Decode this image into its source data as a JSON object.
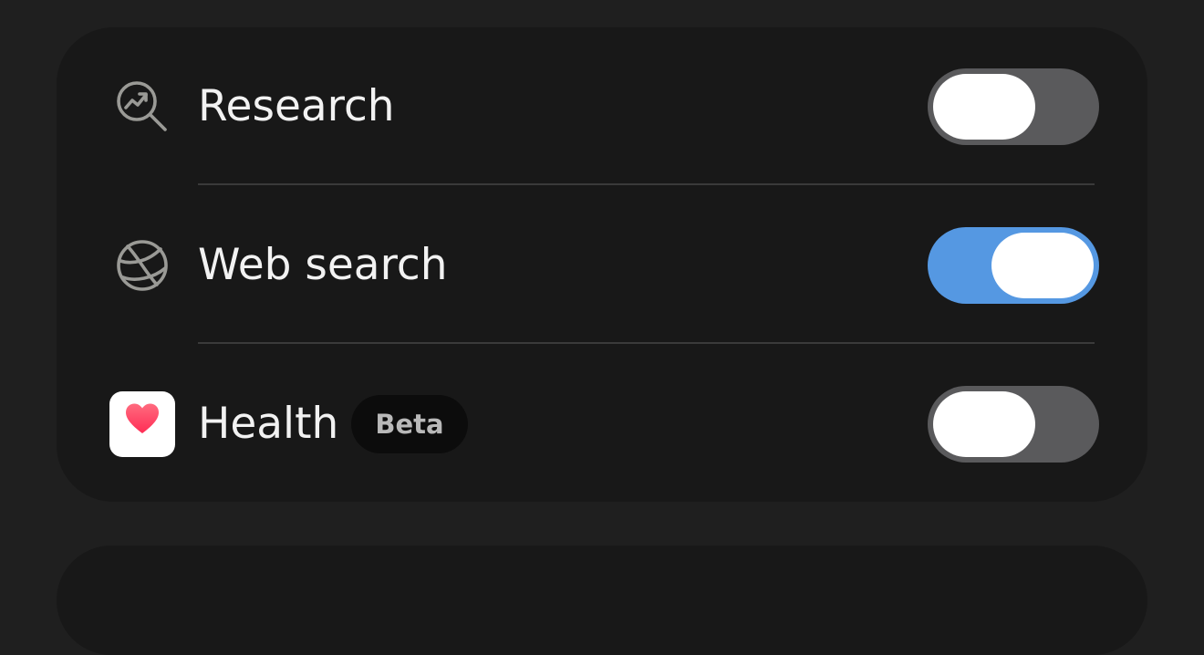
{
  "settings": {
    "items": [
      {
        "label": "Research",
        "icon": "chart-magnifier-icon",
        "enabled": false
      },
      {
        "label": "Web search",
        "icon": "globe-icon",
        "enabled": true
      },
      {
        "label": "Health",
        "icon": "health-app-icon",
        "badge": "Beta",
        "enabled": false
      }
    ]
  },
  "colors": {
    "toggle_on": "#5598e2",
    "toggle_off": "#5a5a5c",
    "card_bg": "#181818",
    "page_bg": "#1f1f1f",
    "heart": "#ff3b5c"
  }
}
